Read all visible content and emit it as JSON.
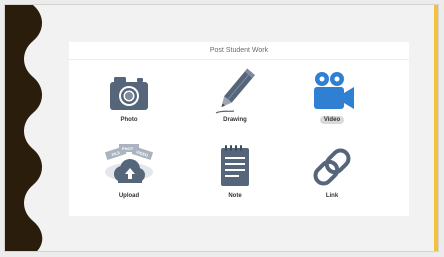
{
  "dialog": {
    "title": "Post Student Work",
    "options": {
      "photo": "Photo",
      "drawing": "Drawing",
      "video": "Video",
      "upload": "Upload",
      "note": "Note",
      "link": "Link"
    },
    "upload_icon_tags": [
      "FILE",
      "PHOTO",
      "VIDEO"
    ],
    "selected": "video"
  },
  "colors": {
    "icon_slate": "#55657a",
    "icon_blue": "#2f7fd2",
    "scallop": "#2a1d0c",
    "accent": "#f3c13a"
  },
  "icons": {
    "photo": "camera-icon",
    "drawing": "pencil-icon",
    "video": "video-camera-icon",
    "upload": "cloud-upload-icon",
    "note": "notepad-icon",
    "link": "chain-link-icon"
  }
}
